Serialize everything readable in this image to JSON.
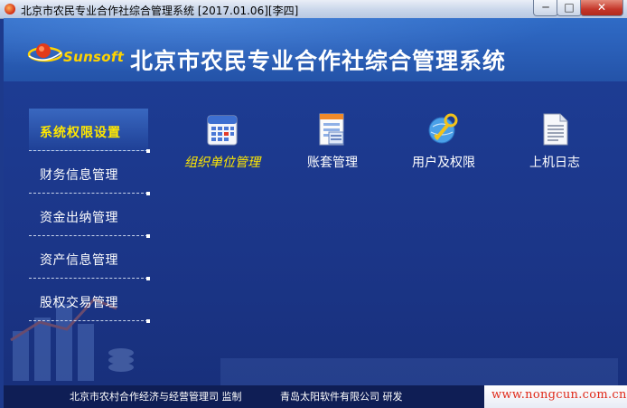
{
  "window": {
    "title": "北京市农民专业合作社综合管理系统 [2017.01.06][李四]",
    "controls": {
      "minimize": "─",
      "maximize": "□",
      "close": "✕"
    }
  },
  "header": {
    "logo_text": "Sunsoft",
    "app_title": "北京市农民专业合作社综合管理系统"
  },
  "sidebar": {
    "items": [
      {
        "label": "系统权限设置",
        "active": true
      },
      {
        "label": "财务信息管理",
        "active": false
      },
      {
        "label": "资金出纳管理",
        "active": false
      },
      {
        "label": "资产信息管理",
        "active": false
      },
      {
        "label": "股权交易管理",
        "active": false
      }
    ]
  },
  "modules": [
    {
      "label": "组织单位管理",
      "icon": "calendar-icon",
      "active": true
    },
    {
      "label": "账套管理",
      "icon": "document-ledger-icon",
      "active": false
    },
    {
      "label": "用户及权限",
      "icon": "key-globe-icon",
      "active": false
    },
    {
      "label": "上机日志",
      "icon": "log-document-icon",
      "active": false
    }
  ],
  "footer": {
    "supervisor": "北京市农村合作经济与经营管理司 监制",
    "developer": "青岛太阳软件有限公司 研发",
    "website": "www.nongcun.com.cn"
  },
  "colors": {
    "accent_yellow": "#ffe800",
    "body_blue": "#1d3a8c",
    "header_blue": "#2a5fb8",
    "website_red": "#e02a1a"
  }
}
